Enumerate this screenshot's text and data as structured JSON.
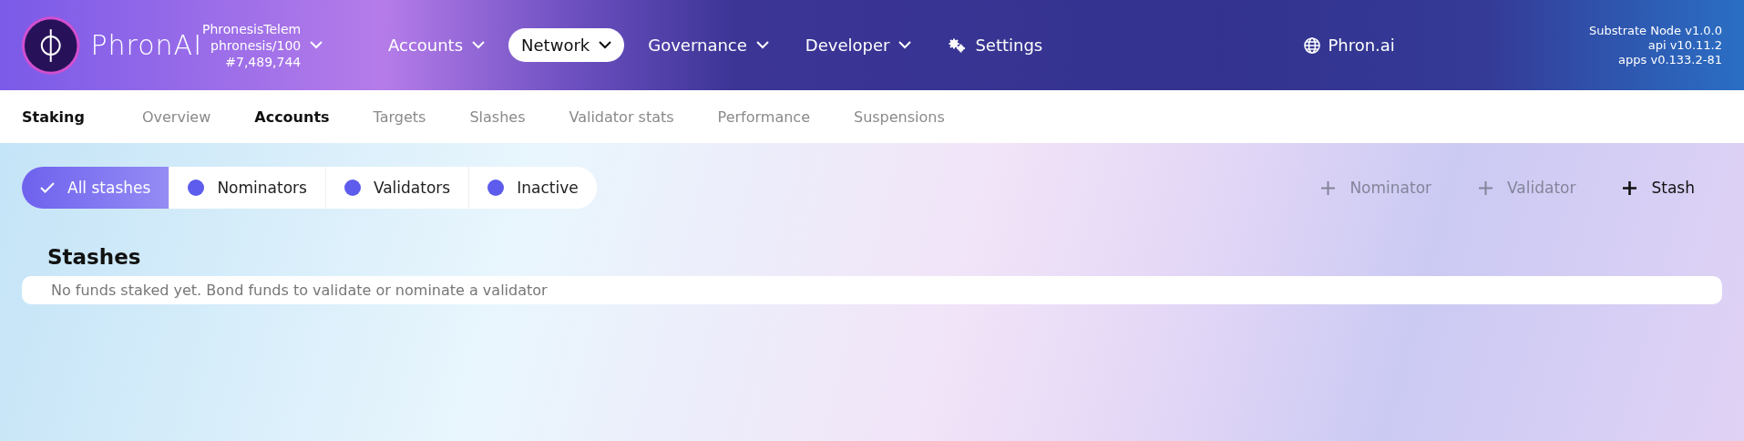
{
  "header": {
    "logo_text": "PhronAI",
    "chain": {
      "name": "PhronesisTelem",
      "runtime": "phronesis/100",
      "block": "#7,489,744"
    },
    "nav": [
      {
        "label": "Accounts",
        "kind": "dropdown",
        "selected": false
      },
      {
        "label": "Network",
        "kind": "dropdown",
        "selected": true
      },
      {
        "label": "Governance",
        "kind": "dropdown",
        "selected": false
      },
      {
        "label": "Developer",
        "kind": "dropdown",
        "selected": false
      },
      {
        "label": "Settings",
        "kind": "settings",
        "selected": false
      }
    ],
    "site_link": "Phron.ai",
    "versions": [
      "Substrate Node v1.0.0",
      "api v10.11.2",
      "apps v0.133.2-81"
    ]
  },
  "subnav": {
    "title": "Staking",
    "tabs": [
      {
        "label": "Overview",
        "selected": false
      },
      {
        "label": "Accounts",
        "selected": true
      },
      {
        "label": "Targets",
        "selected": false
      },
      {
        "label": "Slashes",
        "selected": false
      },
      {
        "label": "Validator stats",
        "selected": false
      },
      {
        "label": "Performance",
        "selected": false
      },
      {
        "label": "Suspensions",
        "selected": false
      }
    ]
  },
  "filters": [
    {
      "label": "All stashes",
      "selected": true
    },
    {
      "label": "Nominators",
      "selected": false
    },
    {
      "label": "Validators",
      "selected": false
    },
    {
      "label": "Inactive",
      "selected": false
    }
  ],
  "actions": [
    {
      "label": "Nominator",
      "disabled": true
    },
    {
      "label": "Validator",
      "disabled": true
    },
    {
      "label": "Stash",
      "disabled": false
    }
  ],
  "stashes": {
    "title": "Stashes",
    "empty_message": "No funds staked yet. Bond funds to validate or nominate a validator"
  }
}
